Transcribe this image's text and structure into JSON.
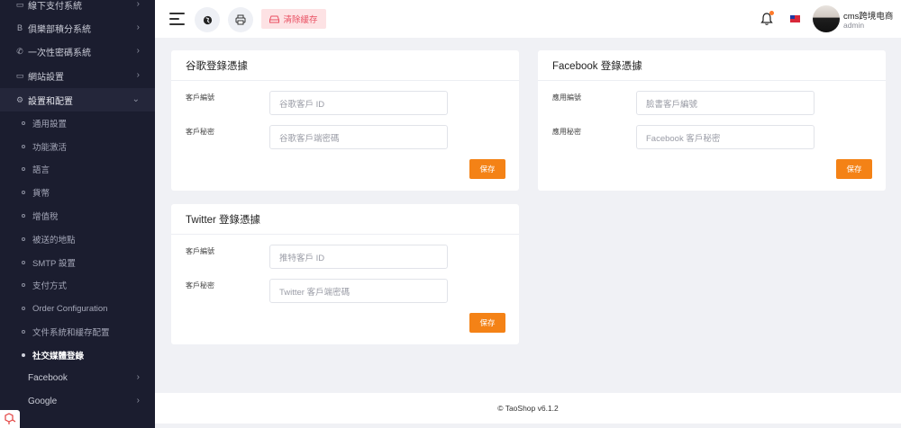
{
  "sidebar": {
    "top_items": [
      {
        "label": "線下支付系統",
        "icon": "cash-icon"
      },
      {
        "label": "俱樂部積分系統",
        "icon": "bitcoin-icon"
      },
      {
        "label": "一次性密碼系統",
        "icon": "phone-icon"
      },
      {
        "label": "網站設置",
        "icon": "monitor-icon"
      },
      {
        "label": "設置和配置",
        "icon": "gear-icon"
      }
    ],
    "sub_items": [
      "通用設置",
      "功能激活",
      "語言",
      "貨幣",
      "增值稅",
      "被送的地點",
      "SMTP 設置",
      "支付方式",
      "Order Configuration",
      "文件系統和緩存配置",
      "社交媒體登錄"
    ],
    "bottom_items": [
      {
        "label": "Facebook"
      },
      {
        "label": "Google"
      }
    ],
    "logo_text": "▽"
  },
  "header": {
    "clear_cache_label": "清除緩存",
    "user_name": "cms跨境电商",
    "user_role": "admin"
  },
  "cards": {
    "google": {
      "title": "谷歌登錄憑據",
      "client_id_label": "客戶編號",
      "client_id_placeholder": "谷歌客戶 ID",
      "client_secret_label": "客戶秘密",
      "client_secret_placeholder": "谷歌客戶端密碼",
      "save_label": "保存"
    },
    "facebook": {
      "title": "Facebook 登錄憑據",
      "app_id_label": "應用編號",
      "app_id_placeholder": "臉書客戶編號",
      "app_secret_label": "應用秘密",
      "app_secret_placeholder": "Facebook 客戶秘密",
      "save_label": "保存"
    },
    "twitter": {
      "title": "Twitter 登錄憑據",
      "client_id_label": "客戶編號",
      "client_id_placeholder": "推特客戶 ID",
      "client_secret_label": "客戶秘密",
      "client_secret_placeholder": "Twitter 客戶端密碼",
      "save_label": "保存"
    }
  },
  "footer": {
    "text": "© TaoShop v6.1.2"
  },
  "colors": {
    "sidebar_bg": "#1b1d2f",
    "accent": "#f48216",
    "clear_cache_bg": "#fde2e4",
    "clear_cache_text": "#e94f61",
    "page_bg": "#f0f1f5"
  }
}
